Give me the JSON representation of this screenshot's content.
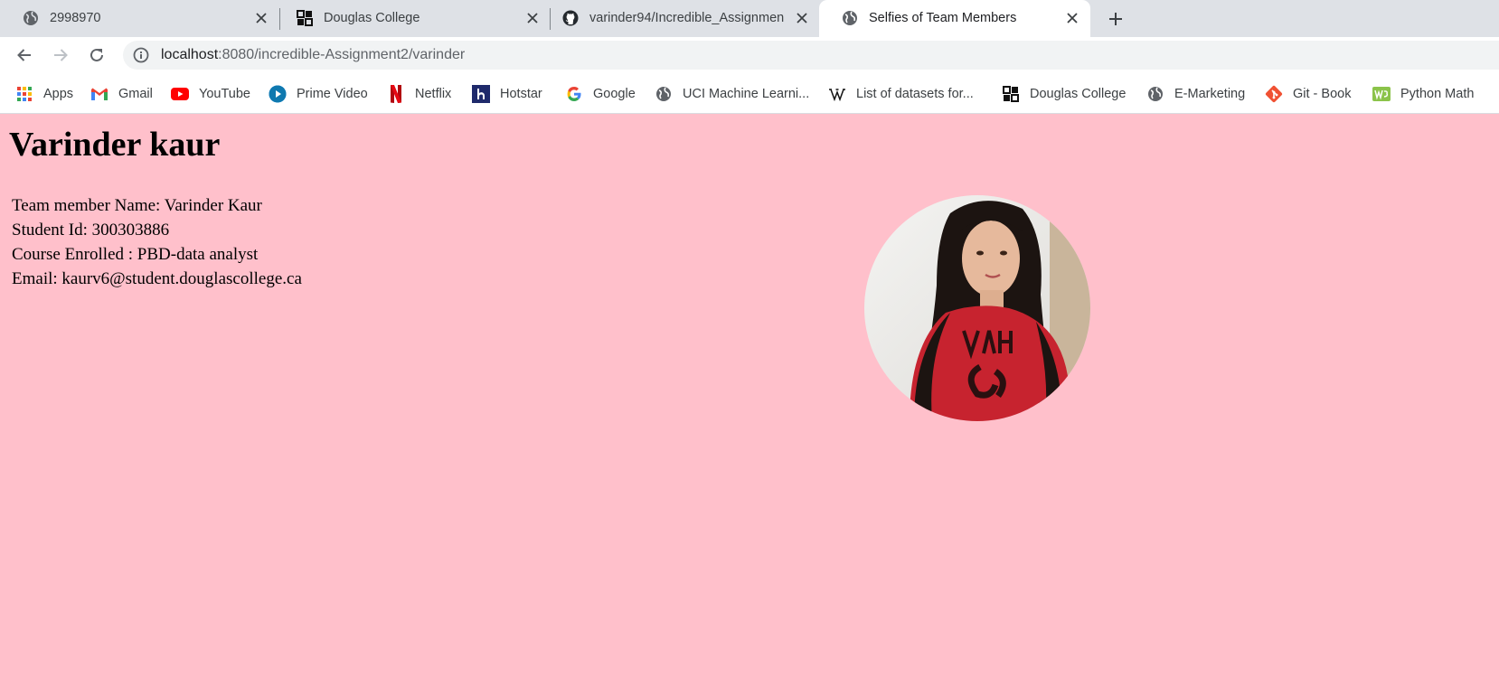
{
  "tabs": [
    {
      "title": "2998970",
      "icon": "globe-icon",
      "active": false
    },
    {
      "title": "Douglas College",
      "icon": "douglas-college-icon",
      "active": false
    },
    {
      "title": "varinder94/Incredible_Assignmen",
      "icon": "github-icon",
      "active": false
    },
    {
      "title": "Selfies of Team Members",
      "icon": "globe-icon",
      "active": true
    }
  ],
  "address_bar": {
    "host": "localhost",
    "path": ":8080/incredible-Assignment2/varinder"
  },
  "bookmarks": [
    {
      "label": "Apps",
      "icon": "apps-grid-icon"
    },
    {
      "label": "Gmail",
      "icon": "gmail-icon"
    },
    {
      "label": "YouTube",
      "icon": "youtube-icon"
    },
    {
      "label": "Prime Video",
      "icon": "prime-video-icon"
    },
    {
      "label": "Netflix",
      "icon": "netflix-icon"
    },
    {
      "label": "Hotstar",
      "icon": "hotstar-icon"
    },
    {
      "label": "Google",
      "icon": "google-icon"
    },
    {
      "label": "UCI Machine Learni...",
      "icon": "globe-icon"
    },
    {
      "label": "List of datasets for...",
      "icon": "wikipedia-icon"
    },
    {
      "label": "Douglas College",
      "icon": "douglas-college-icon"
    },
    {
      "label": "E-Marketing",
      "icon": "globe-icon"
    },
    {
      "label": "Git - Book",
      "icon": "git-icon"
    },
    {
      "label": "Python Math",
      "icon": "w3schools-icon"
    }
  ],
  "page": {
    "heading": "Varinder kaur",
    "lines": [
      "Team member Name: Varinder Kaur",
      "Student Id: 300303886",
      "Course Enrolled : PBD-data analyst",
      "Email: kaurv6@student.douglascollege.ca"
    ],
    "photo_label": "profile-photo"
  },
  "colors": {
    "page_background": "#ffc0cb",
    "tab_strip": "#dee1e6",
    "omnibox": "#f1f3f4"
  }
}
